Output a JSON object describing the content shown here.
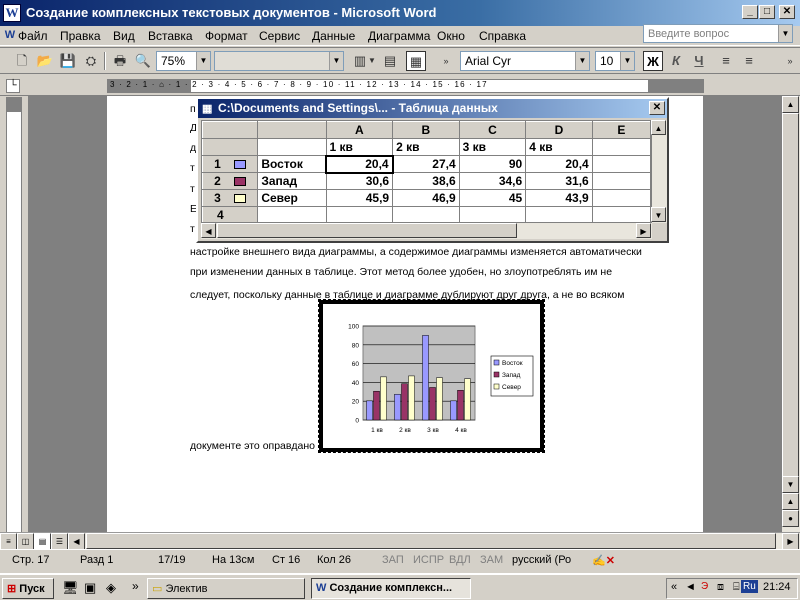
{
  "window": {
    "title": "Создание комплексных текстовых документов - Microsoft Word"
  },
  "menu": [
    "Файл",
    "Правка",
    "Вид",
    "Вставка",
    "Формат",
    "Сервис",
    "Данные",
    "Диаграмма",
    "Окно",
    "Справка"
  ],
  "ask": {
    "placeholder": "Введите вопрос"
  },
  "toolbar": {
    "zoom": "75%",
    "font": "Arial Cyr",
    "size": "10",
    "bold": "Ж",
    "italic": "К",
    "underline": "Ч"
  },
  "ruler": {
    "marks": "3 · 2 · 1 · ⌂ · 1 · 2 · 3 · 4 · 5 · 6 · 7 · 8 · 9 · 10 · 11 · 12 · 13 · 14 · 15 · 16 · 17"
  },
  "document": {
    "left_chars": [
      "п",
      "Д",
      "д",
      "т",
      "т",
      "Е",
      "т"
    ],
    "lines": [
      "настройке внешнего вида диаграммы, а содержимое диаграммы изменяется автоматически",
      "при изменении данных в таблице. Этот метод более удобен, но злоупотреблять им не",
      "следует, поскольку данные в таблице и диаграмме дублируют друг друга, а не во всяком",
      "документе это оправдано"
    ]
  },
  "datasheet": {
    "title": "C:\\Documents and Settings\\... - Таблица данных",
    "columns": [
      "A",
      "B",
      "C",
      "D",
      "E"
    ],
    "header_row": [
      "1 кв",
      "2 кв",
      "3 кв",
      "4 кв",
      ""
    ],
    "rows": [
      {
        "num": "1",
        "name": "Восток",
        "values": [
          "20,4",
          "27,4",
          "90",
          "20,4"
        ]
      },
      {
        "num": "2",
        "name": "Запад",
        "values": [
          "30,6",
          "38,6",
          "34,6",
          "31,6"
        ]
      },
      {
        "num": "3",
        "name": "Север",
        "values": [
          "45,9",
          "46,9",
          "45",
          "43,9"
        ]
      },
      {
        "num": "4",
        "name": "",
        "values": [
          "",
          "",
          "",
          ""
        ]
      }
    ]
  },
  "chart_data": {
    "type": "bar",
    "categories": [
      "1 кв",
      "2 кв",
      "3 кв",
      "4 кв"
    ],
    "series": [
      {
        "name": "Восток",
        "values": [
          20.4,
          27.4,
          90,
          20.4
        ],
        "color": "#9999ff"
      },
      {
        "name": "Запад",
        "values": [
          30.6,
          38.6,
          34.6,
          31.6
        ],
        "color": "#993366"
      },
      {
        "name": "Север",
        "values": [
          45.9,
          46.9,
          45,
          43.9
        ],
        "color": "#ffffcc"
      }
    ],
    "y_ticks": [
      "0",
      "20",
      "40",
      "60",
      "80",
      "100"
    ],
    "ylim": [
      0,
      100
    ],
    "legend": "right",
    "grid": true,
    "wall_color": "#c0c0c0"
  },
  "status": {
    "page": "Стр. 17",
    "section": "Разд 1",
    "pages": "17/19",
    "at": "На 13см",
    "line": "Ст 16",
    "col": "Кол 26",
    "rec": "ЗАП",
    "trk": "ИСПР",
    "ext": "ВДЛ",
    "ovr": "ЗАМ",
    "lang": "русский (Ро"
  },
  "taskbar": {
    "start": "Пуск",
    "folder": "Электив",
    "word": "Создание комплексн...",
    "lang": "Ru",
    "time": "21:24"
  }
}
